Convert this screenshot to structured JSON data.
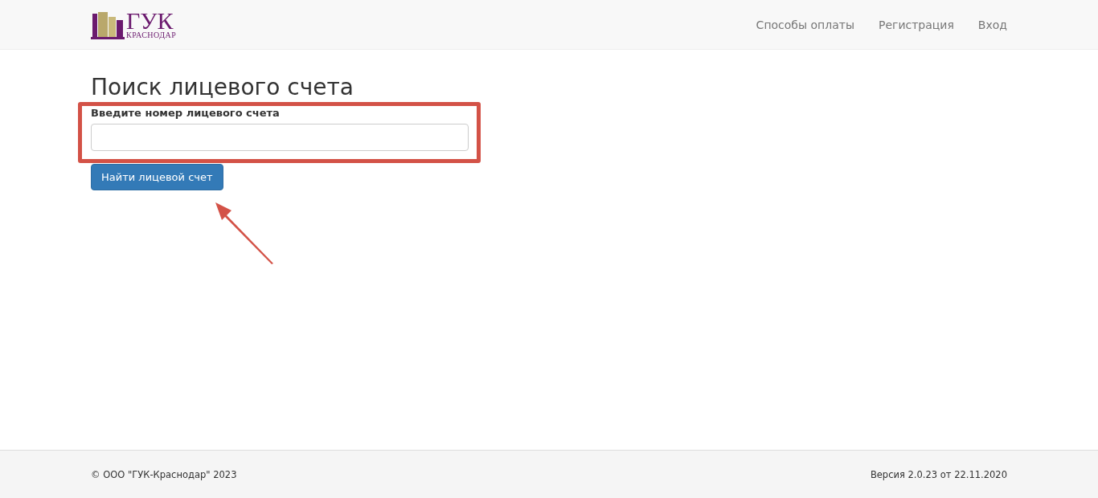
{
  "header": {
    "logo": {
      "title": "ГУК",
      "subtitle": "КРАСНОДАР"
    },
    "nav": [
      {
        "label": "Способы оплаты"
      },
      {
        "label": "Регистрация"
      },
      {
        "label": "Вход"
      }
    ]
  },
  "page": {
    "title": "Поиск лицевого счета",
    "field": {
      "label": "Введите номер лицевого счета"
    },
    "button": "Найти лицевой счет"
  },
  "footer": {
    "copyright": "© ООО \"ГУК-Краснодар\" 2023",
    "version": "Версия 2.0.23 от 22.11.2020"
  }
}
